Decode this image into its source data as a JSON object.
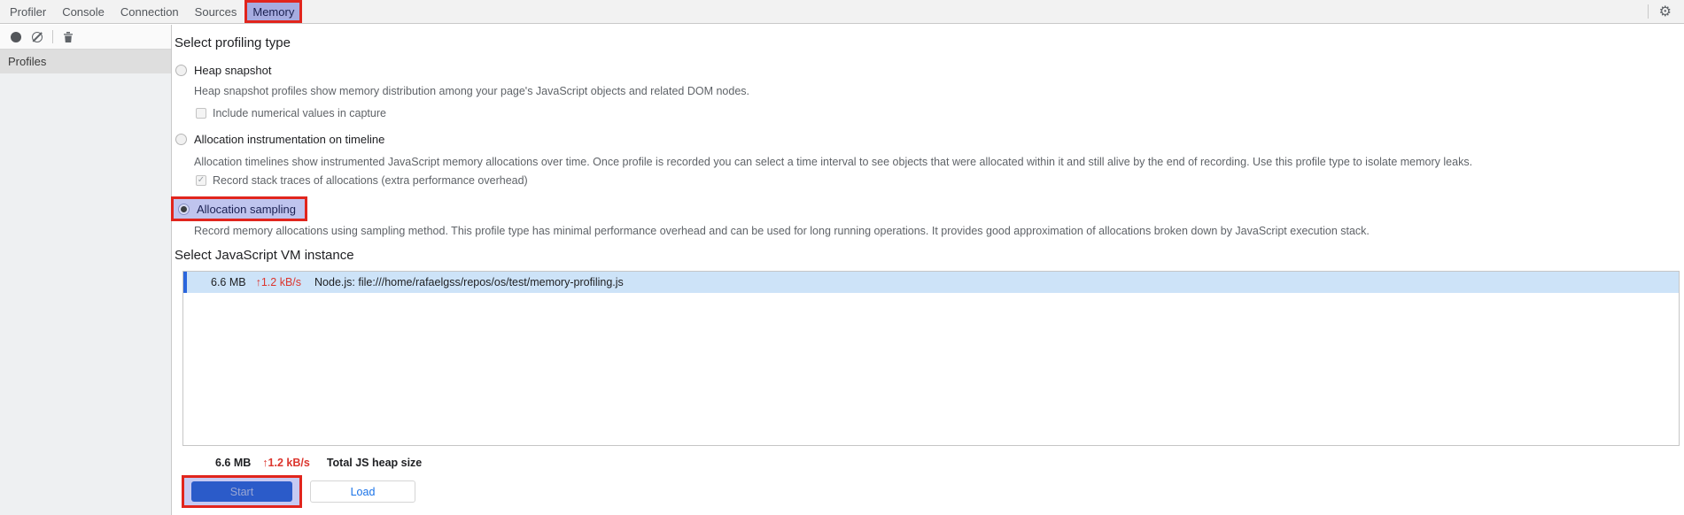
{
  "tabs": {
    "items": [
      "Profiler",
      "Console",
      "Connection",
      "Sources",
      "Memory"
    ],
    "selected": "Memory"
  },
  "icons": {
    "gear": "⚙",
    "check": "✓",
    "toolbar_icon_names": [
      "record-icon",
      "block-icon",
      "trash-icon"
    ]
  },
  "sidebar": {
    "header": "Profiles"
  },
  "profiling": {
    "heading": "Select profiling type",
    "options": [
      {
        "label": "Heap snapshot",
        "selected": false,
        "description": "Heap snapshot profiles show memory distribution among your page's JavaScript objects and related DOM nodes."
      },
      {
        "label": "Allocation instrumentation on timeline",
        "selected": false,
        "description": "Allocation timelines show instrumented JavaScript memory allocations over time. Once profile is recorded you can select a time interval to see objects that were allocated within it and still alive by the end of recording. Use this profile type to isolate memory leaks."
      },
      {
        "label": "Allocation sampling",
        "selected": true,
        "highlighted": true,
        "description": "Record memory allocations using sampling method. This profile type has minimal performance overhead and can be used for long running operations. It provides good approximation of allocations broken down by JavaScript execution stack."
      }
    ],
    "checkboxes": [
      {
        "label": "Include numerical values in capture",
        "checked": false
      },
      {
        "label": "Record stack traces of allocations (extra performance overhead)",
        "checked": true
      }
    ]
  },
  "vm": {
    "heading": "Select JavaScript VM instance",
    "rows": [
      {
        "heap_size": "6.6 MB",
        "trend": "↑1.2 kB/s",
        "name": "Node.js: file:///home/rafaelgss/repos/os/test/memory-profiling.js",
        "selected": true
      }
    ],
    "total": {
      "heap_size": "6.6 MB",
      "trend": "↑1.2 kB/s",
      "label": "Total JS heap size"
    }
  },
  "actions": {
    "start": "Start",
    "load": "Load"
  },
  "colors": {
    "annotation_red": "#e1251d",
    "annotation_lavender": "#bfc4ee",
    "tab_highlight": "#a6ace0",
    "row_selection": "#cde3f8",
    "row_accent": "#2a66dd",
    "trend_red": "#dc362e",
    "primary_button_blue": "#2b5bc9",
    "link_blue": "#1a73e8"
  }
}
